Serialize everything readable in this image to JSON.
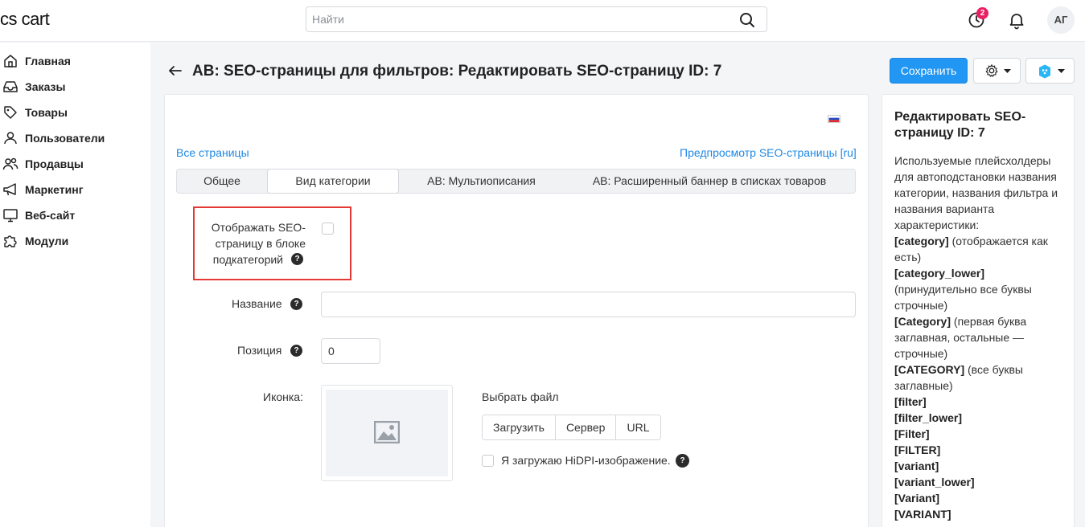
{
  "app": {
    "logo": "cs cart",
    "search_placeholder": "Найти",
    "notification_count": "2",
    "avatar_initials": "АГ"
  },
  "sidebar": {
    "items": [
      {
        "label": "Главная",
        "icon": "home-icon"
      },
      {
        "label": "Заказы",
        "icon": "inbox-icon"
      },
      {
        "label": "Товары",
        "icon": "tag-icon"
      },
      {
        "label": "Пользователи",
        "icon": "user-icon"
      },
      {
        "label": "Продавцы",
        "icon": "users-icon"
      },
      {
        "label": "Маркетинг",
        "icon": "megaphone-icon"
      },
      {
        "label": "Веб-сайт",
        "icon": "monitor-icon"
      },
      {
        "label": "Модули",
        "icon": "puzzle-icon"
      }
    ]
  },
  "header": {
    "title": "AB: SEO-страницы для фильтров: Редактировать SEO-страницу ID: 7",
    "save_label": "Сохранить"
  },
  "main": {
    "all_pages_link": "Все страницы",
    "preview_link": "Предпросмотр SEO-страницы [ru]",
    "tabs": [
      {
        "label": "Общее",
        "active": false
      },
      {
        "label": "Вид категории",
        "active": true
      },
      {
        "label": "AB: Мультиописания",
        "active": false
      },
      {
        "label": "AB: Расширенный баннер в списках товаров",
        "active": false
      }
    ],
    "show_in_subcategories_label_line1": "Отображать SEO-",
    "show_in_subcategories_label_line2": "страницу в блоке",
    "show_in_subcategories_label_line3": "подкатегорий",
    "name_label": "Название",
    "name_value": "",
    "position_label": "Позиция",
    "position_value": "0",
    "icon_label": "Иконка:",
    "choose_file_label": "Выбрать файл",
    "upload_buttons": [
      "Загрузить",
      "Сервер",
      "URL"
    ],
    "hidpi_label": "Я загружаю HiDPI-изображение."
  },
  "side_panel": {
    "title": "Редактировать SEO-страницу ID: 7",
    "intro": "Используемые плейсхолдеры для автоподстановки названия категории, названия фильтра и названия варианта характеристики:",
    "placeholders": [
      {
        "key": "[category]",
        "desc": " (отображается как есть)"
      },
      {
        "key": "[category_lower]",
        "desc": " (принудительно все буквы строчные)"
      },
      {
        "key": "[Category]",
        "desc": " (первая буква заглавная, остальные — строчные)"
      },
      {
        "key": "[CATEGORY]",
        "desc": " (все буквы заглавные)"
      },
      {
        "key": "[filter]",
        "desc": ""
      },
      {
        "key": "[filter_lower]",
        "desc": ""
      },
      {
        "key": "[Filter]",
        "desc": ""
      },
      {
        "key": "[FILTER]",
        "desc": ""
      },
      {
        "key": "[variant]",
        "desc": ""
      },
      {
        "key": "[variant_lower]",
        "desc": ""
      },
      {
        "key": "[Variant]",
        "desc": ""
      },
      {
        "key": "[VARIANT]",
        "desc": ""
      }
    ]
  },
  "colors": {
    "accent": "#2196f3",
    "link": "#1e88e5",
    "highlight": "#e53935",
    "badge": "#e91e63"
  }
}
